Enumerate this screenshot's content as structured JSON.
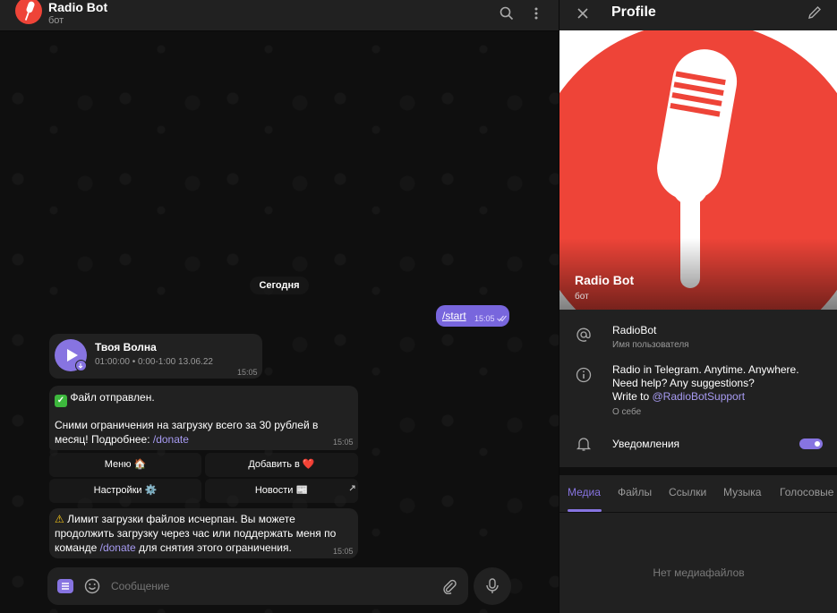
{
  "chat": {
    "header": {
      "title": "Radio Bot",
      "subtitle": "бот"
    },
    "date_chip": "Сегодня",
    "outgoing": {
      "text": "/start",
      "time": "15:05"
    },
    "audio_message": {
      "title": "Твоя Волна",
      "meta": "01:00:00 • 0:00-1:00 13.06.22",
      "time": "15:05"
    },
    "file_sent": {
      "line1": "Файл отправлен.",
      "line2": "Сними ограничения на загрузку всего за 30 рублей в",
      "line3_prefix": "месяц! Подробнее: ",
      "line3_link": "/donate",
      "time": "15:05"
    },
    "keyboard": {
      "menu": "Меню 🏠",
      "add_to": "Добавить в ❤️",
      "settings": "Настройки ⚙️",
      "news": "Новости 📰"
    },
    "limit": {
      "line1": "Лимит загрузки файлов исчерпан. Вы можете",
      "line2": "продолжить загрузку через час или поддержать меня по",
      "line3_prefix": "команде ",
      "line3_link": "/donate",
      "line3_suffix": " для снятия этого ограничения.",
      "time": "15:05"
    },
    "composer": {
      "placeholder": "Сообщение"
    }
  },
  "profile": {
    "header_title": "Profile",
    "hero_name": "Radio Bot",
    "hero_sub": "бот",
    "username": "RadioBot",
    "username_label": "Имя пользователя",
    "bio_line1": "Radio in Telegram. Anytime. Anywhere.",
    "bio_line2": "Need help? Any suggestions?",
    "bio_line3_prefix": "Write to ",
    "bio_line3_link": "@RadioBotSupport",
    "bio_label": "О себе",
    "notifications_label": "Уведомления",
    "notifications_on": true,
    "tabs": [
      "Медиа",
      "Файлы",
      "Ссылки",
      "Музыка",
      "Голосовые"
    ],
    "active_tab": "Медиа",
    "empty_text": "Нет медиафайлов"
  },
  "colors": {
    "accent": "#8774e1",
    "brand_red": "#ee4438",
    "out_bubble": "#7866dd"
  },
  "icons": [
    "search-icon",
    "more-vertical-icon",
    "close-icon",
    "edit-icon",
    "at-icon",
    "info-icon",
    "bell-icon",
    "play-icon",
    "download-icon",
    "bot-menu-icon",
    "emoji-icon",
    "attach-icon",
    "mic-icon",
    "expand-arrow-icon",
    "check-box-icon",
    "warning-icon"
  ]
}
